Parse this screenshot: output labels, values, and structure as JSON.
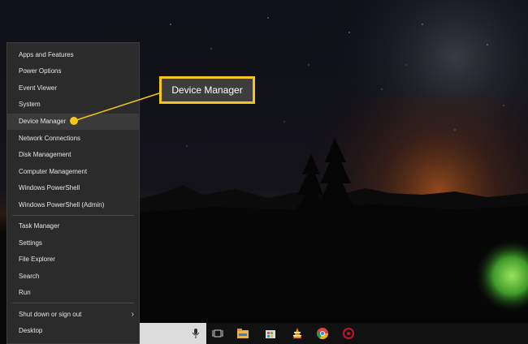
{
  "menu": {
    "items": [
      {
        "label": "Apps and Features"
      },
      {
        "label": "Power Options"
      },
      {
        "label": "Event Viewer"
      },
      {
        "label": "System"
      },
      {
        "label": "Device Manager"
      },
      {
        "label": "Network Connections"
      },
      {
        "label": "Disk Management"
      },
      {
        "label": "Computer Management"
      },
      {
        "label": "Windows PowerShell"
      },
      {
        "label": "Windows PowerShell (Admin)"
      },
      {
        "label": "Task Manager"
      },
      {
        "label": "Settings"
      },
      {
        "label": "File Explorer"
      },
      {
        "label": "Search"
      },
      {
        "label": "Run"
      },
      {
        "label": "Shut down or sign out"
      },
      {
        "label": "Desktop"
      }
    ]
  },
  "callout": {
    "label": "Device Manager"
  },
  "colors": {
    "accent": "#f5c518",
    "menu_bg": "#2b2b2b",
    "taskbar_bg": "#111111"
  },
  "taskbar": {
    "icons": [
      "microphone-icon",
      "task-view-icon",
      "file-explorer-icon",
      "store-icon",
      "vlc-icon",
      "chrome-icon",
      "app-icon"
    ]
  }
}
